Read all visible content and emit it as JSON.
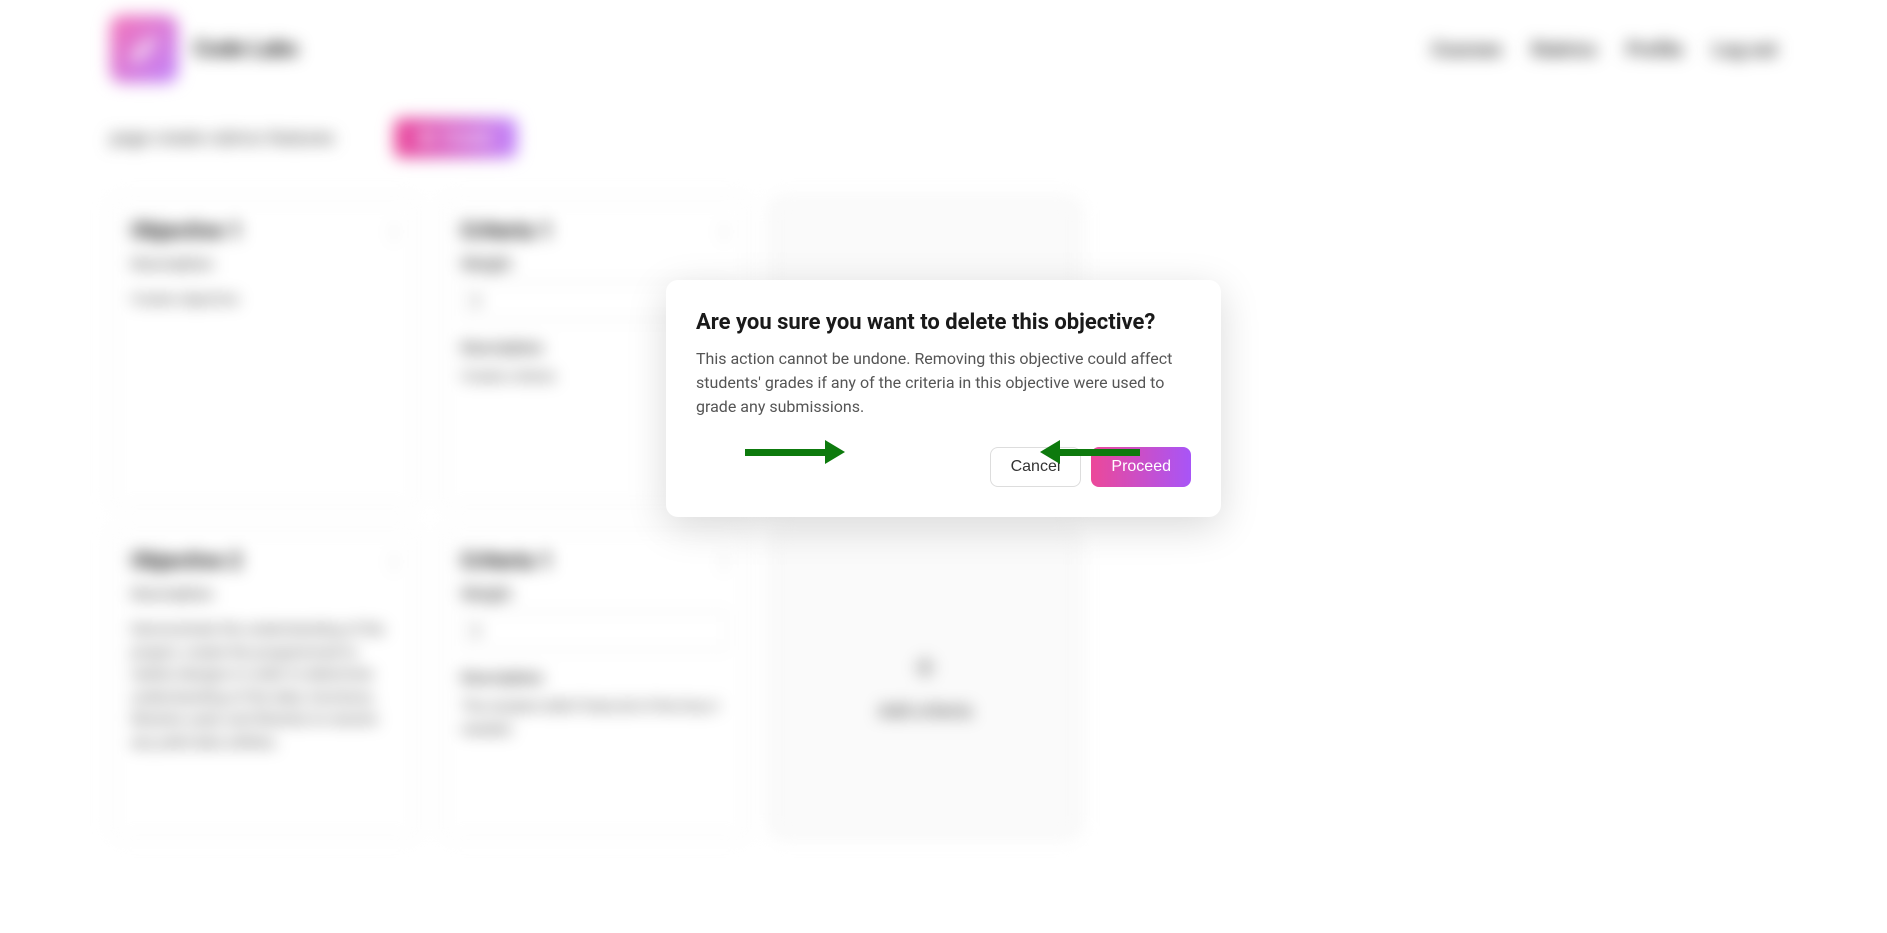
{
  "header": {
    "app_name": "Code Labs",
    "nav": {
      "courses": "Courses",
      "rubrics": "Rubrics",
      "profile": "Profile",
      "logout": "Log out"
    }
  },
  "breadcrumb": "page create rubrics features",
  "create_button": "Create",
  "objectives": {
    "obj1": {
      "title": "Objective 1",
      "subtitle": "Description",
      "desc": "Create objective"
    },
    "obj2": {
      "title": "Objective 2",
      "subtitle": "Description",
      "desc": "Demonstrate the understanding of the project, create the programmed to realize designs in order to determine understanding of the data, functions, libraries used, and libraries to resolve any yield data utilities."
    }
  },
  "criteria": {
    "crit1": {
      "title": "Criteria 1",
      "weight_label": "Weight",
      "weight_value": "1",
      "desc_label": "Description",
      "desc_value": "Create criteria"
    },
    "crit2": {
      "title": "Criteria 1",
      "weight_label": "Weight",
      "weight_value": "1",
      "desc_label": "Description",
      "desc_value": "The student didn't fixed all of the linux I needed."
    }
  },
  "add_criteria": "Add criteria",
  "modal": {
    "title": "Are you sure you want to delete this objective?",
    "body": "This action cannot be undone. Removing this objective could affect students' grades if any of the criteria in this objective were used to grade any submissions.",
    "cancel": "Cancel",
    "proceed": "Proceed"
  }
}
